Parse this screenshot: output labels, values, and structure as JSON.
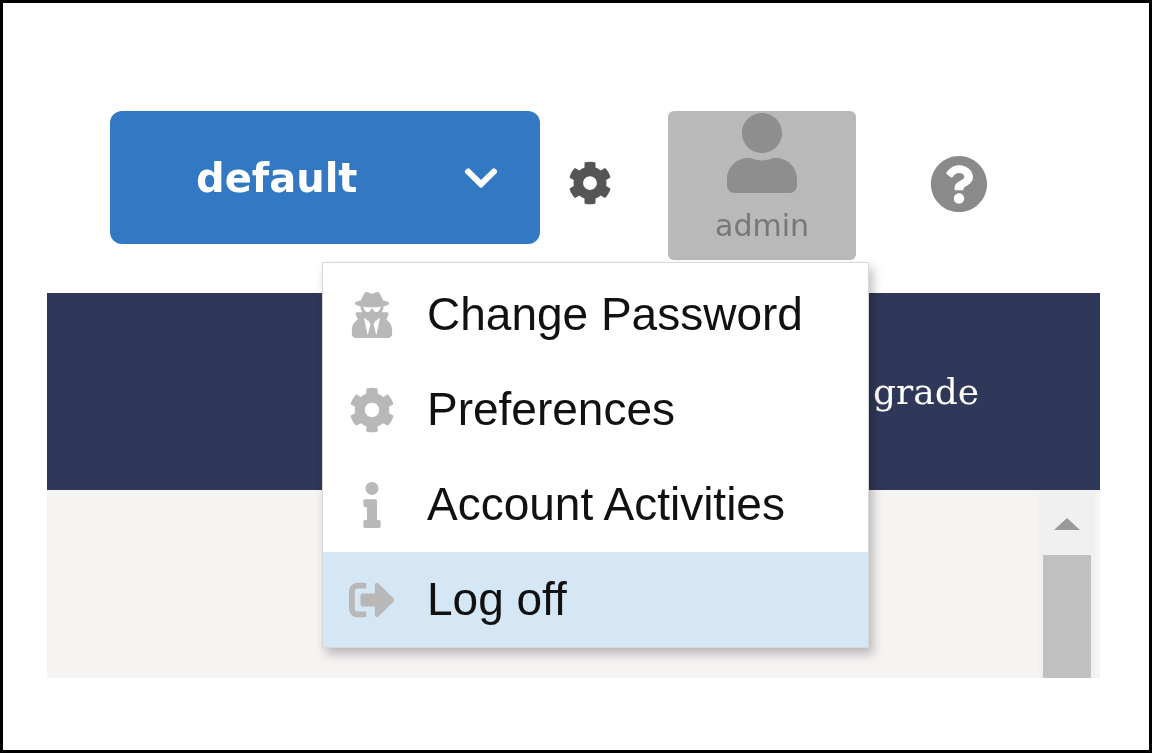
{
  "workspace_selector": {
    "label": "default"
  },
  "user": {
    "name": "admin"
  },
  "nav_bar": {
    "text": "grade"
  },
  "user_menu": {
    "items": [
      {
        "kind": "password",
        "label": "Change Password",
        "selected": false
      },
      {
        "kind": "preferences",
        "label": "Preferences",
        "selected": false
      },
      {
        "kind": "activities",
        "label": "Account Activities",
        "selected": false
      },
      {
        "kind": "logoff",
        "label": "Log off",
        "selected": true
      }
    ]
  }
}
